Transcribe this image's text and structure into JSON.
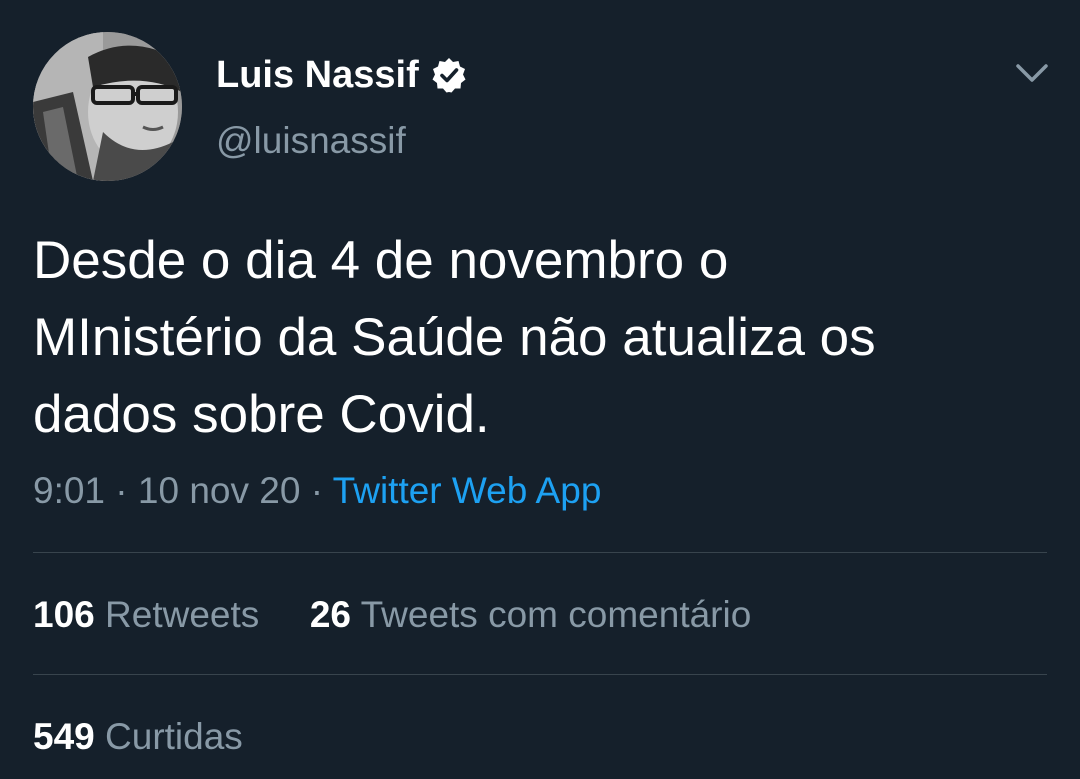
{
  "author": {
    "display_name": "Luis Nassif",
    "handle": "@luisnassif",
    "verified": true
  },
  "tweet": {
    "text": "Desde o dia 4 de novembro o\nMInistério da Saúde não atualiza os\ndados sobre Covid.",
    "time": "9:01",
    "separator": "·",
    "date": "10 nov 20",
    "source": "Twitter Web App"
  },
  "stats": {
    "retweets_count": "106",
    "retweets_label": "Retweets",
    "quotes_count": "26",
    "quotes_label": "Tweets com comentário",
    "likes_count": "549",
    "likes_label": "Curtidas"
  },
  "icons": {
    "verified": "verified-badge-icon",
    "menu": "chevron-down-icon"
  },
  "colors": {
    "background": "#15202b",
    "primary_text": "#ffffff",
    "secondary_text": "#8899a6",
    "link": "#1da1f2",
    "divider": "#38444d"
  }
}
